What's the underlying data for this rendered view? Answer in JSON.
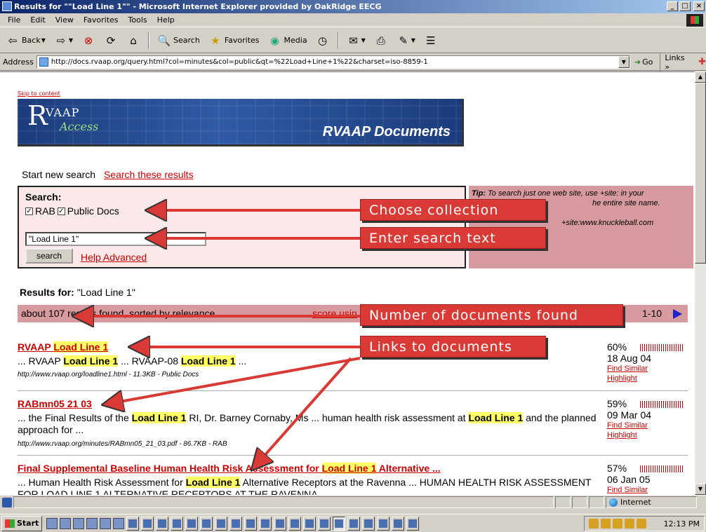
{
  "window": {
    "title": "Results for \"\"Load Line 1\"\" - Microsoft Internet Explorer provided by OakRidge EECG",
    "controls": [
      "_",
      "□",
      "×"
    ]
  },
  "menu": [
    "File",
    "Edit",
    "View",
    "Favorites",
    "Tools",
    "Help"
  ],
  "toolbar": {
    "back": "Back",
    "search": "Search",
    "favorites": "Favorites",
    "media": "Media"
  },
  "address": {
    "label": "Address",
    "url": "http://docs.rvaap.org/query.html?col=minutes&col=public&qt=%22Load+Line+1%22&charset=iso-8859-1",
    "go": "Go",
    "links": "Links"
  },
  "page": {
    "skip": "Skip to content",
    "banner": {
      "logo_r": "R",
      "logo_vaap": "VAAP",
      "logo_access": "Access",
      "title": "RVAAP Documents"
    },
    "new_search": "Start new search",
    "search_these": "Search these results",
    "search_label": "Search:",
    "collections": [
      "RAB",
      "Public Docs"
    ],
    "query": "\"Load Line 1\"",
    "search_button": "search",
    "help": "Help",
    "advanced": "Advanced",
    "tip_label": "Tip:",
    "tip_line1": "To search just one web site, use +site: in your",
    "tip_line2": "he entire site name.",
    "tip_line3": "+site:www.knuckleball.com",
    "results_for_label": "Results for:",
    "results_for_query": "\"Load Line 1\"",
    "count_text": "about 107 re",
    "count_tail": "sults found, sorted by relevance",
    "score_link": "score usin",
    "range": "1-10"
  },
  "results": [
    {
      "title_pre": "RVAAP ",
      "title_hl": "Load Line 1",
      "title_post": "",
      "snip": [
        "... RVAAP ",
        "Load Line 1",
        " ... RVAAP-08 ",
        "Load Line 1",
        " ..."
      ],
      "url": "http://www.rvaap.org/loadline1.html - 11.3KB - Public Docs",
      "score": "60%",
      "date": "18 Aug 04",
      "similar": "Find Similar",
      "highlight": "Highlight"
    },
    {
      "title_pre": "RABmn05 21 03",
      "snip": [
        "... the Final Results of the ",
        "Load Line 1",
        " RI, Dr. Barney Cornaby, Ms ... human health risk assessment at ",
        "Load Line 1",
        " and the planned approach for ..."
      ],
      "url": "http://www.rvaap.org/minutes/RABmn05_21_03.pdf - 86.7KB - RAB",
      "score": "59%",
      "date": "09 Mar 04",
      "similar": "Find Similar",
      "highlight": "Highlight"
    },
    {
      "title_pre": "Final Supplemental Baseline Human Health Risk Assessment for ",
      "title_hl": "Load Line 1",
      "title_post": " Alternative ...",
      "snip": [
        "... Human Health Risk Assessment for ",
        "Load Line 1",
        " Alternative Receptors at the Ravenna ... HUMAN HEALTH RISK ASSESSMENT FOR LOAD LINE 1 ALTERNATIVE RECEPTORS AT THE RAVENNA"
      ],
      "score": "57%",
      "date": "06 Jan 05",
      "similar": "Find Similar"
    }
  ],
  "callouts": {
    "collection": "Choose collection",
    "search_text": "Enter search text",
    "num_docs": "Number of documents found",
    "links": "Links to documents"
  },
  "status": {
    "zone": "Internet"
  },
  "taskbar": {
    "start": "Start",
    "clock": "12:13 PM"
  },
  "colors": {
    "link": "#cc0000",
    "highlight": "#ffff66",
    "callout": "#d93a35",
    "panel_pink": "#d69a9f"
  }
}
